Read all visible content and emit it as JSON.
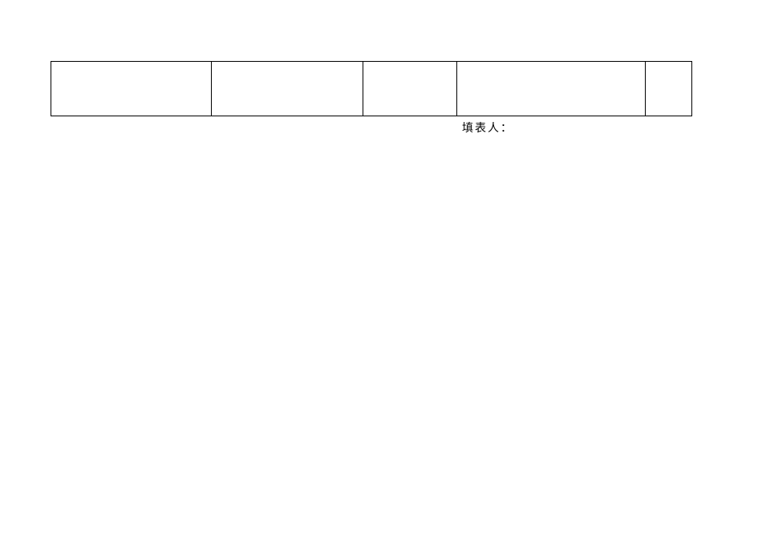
{
  "table": {
    "rows": [
      {
        "c1": "",
        "c2": "",
        "c3": "",
        "c4": "",
        "c5": ""
      }
    ]
  },
  "footer": {
    "filler_label": "填表人："
  }
}
